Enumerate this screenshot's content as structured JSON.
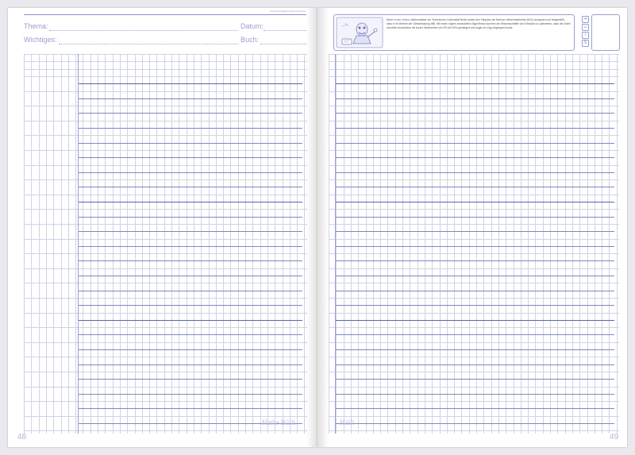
{
  "left_page": {
    "header": {
      "small_caption": "Hinweis/Aufgaben/Arbeitsmaterial",
      "thema_label": "Thema:",
      "datum_label": "Datum:",
      "wichtiges_label": "Wichtiges:",
      "buch_label": "Buch:"
    },
    "footer_label": "Hathe Hälft",
    "page_number": "48"
  },
  "right_page": {
    "info": {
      "title": "Meier in der Uhlen:",
      "body": "Mathematiker der Technischen Universität Berlin haben den Fahrplan der Berliner Verkehrsbetriebe (BVG) analysiert und festgestellt, dass er im Betrieb der Gleisbelastung fällt. Mit einem eigens entwickelten Algorithmus konnten die Wissenschaftler den Fahrplan so optimieren, dass der Anteil schneller Anschlüsse mit kurzer Wartezeiten von 5% auf 60% gesteigert und sogar ein Zug eingespart wurde."
    },
    "icons": [
      "arrow-icon",
      "smiley-icon",
      "info-icon",
      "s-icon"
    ],
    "footer_label": "Hälft",
    "page_number": "49"
  },
  "colors": {
    "accent": "#7f86c2",
    "grid": "#cfd3e6",
    "label": "#9b9ec9"
  }
}
